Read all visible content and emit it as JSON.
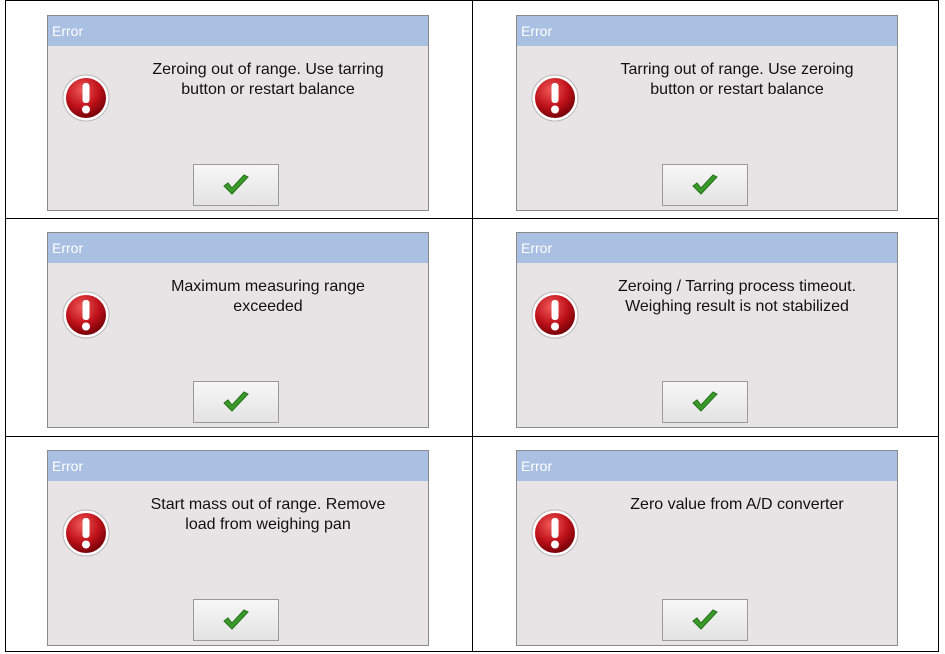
{
  "dialogs": [
    {
      "title": "Error",
      "message_line1": "Zeroing out of range. Use tarring",
      "message_line2": "button or restart balance"
    },
    {
      "title": "Error",
      "message_line1": "Tarring out of range. Use zeroing",
      "message_line2": "button or restart balance"
    },
    {
      "title": "Error",
      "message_line1": "Maximum measuring range",
      "message_line2": "exceeded"
    },
    {
      "title": "Error",
      "message_line1": "Zeroing / Tarring process timeout.",
      "message_line2": "Weighing result is not stabilized"
    },
    {
      "title": "Error",
      "message_line1": "Start mass out of range. Remove",
      "message_line2": "load from weighing pan"
    },
    {
      "title": "Error",
      "message_line1": "Zero value from A/D converter",
      "message_line2": ""
    }
  ],
  "icons": {
    "error": "error-exclamation-icon",
    "confirm": "checkmark-icon"
  },
  "colors": {
    "titlebar": "#a9c0e3",
    "dialog_bg": "#e8e4e5",
    "error_red": "#c0121a",
    "check_green": "#3a9a2a"
  }
}
